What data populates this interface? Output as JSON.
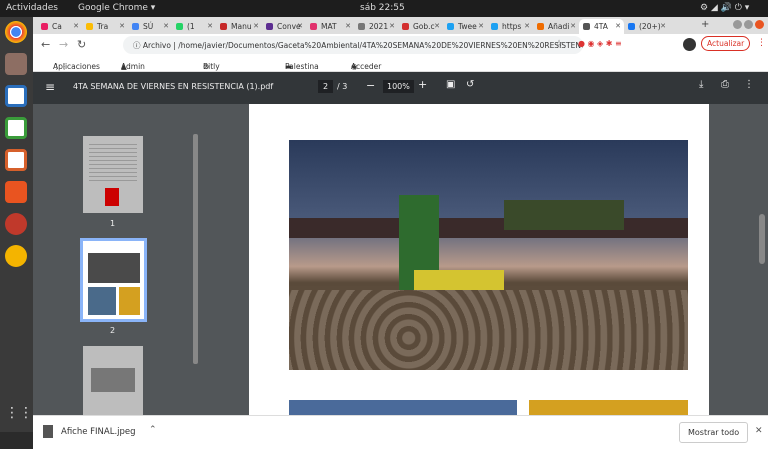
{
  "system": {
    "activities": "Actividades",
    "app": "Google Chrome ▾",
    "clock": "sáb 22:55"
  },
  "tabs": [
    {
      "label": "Ca",
      "color": "#e91e63"
    },
    {
      "label": "Tra",
      "color": "#fbbc04"
    },
    {
      "label": "SÚ",
      "color": "#4285f4"
    },
    {
      "label": "(1",
      "color": "#25d366"
    },
    {
      "label": "Manu",
      "color": "#c62828"
    },
    {
      "label": "Conve",
      "color": "#5c2d91"
    },
    {
      "label": "MAT",
      "color": "#e1306c"
    },
    {
      "label": "2021",
      "color": "#777"
    },
    {
      "label": "Gob.c",
      "color": "#d32f2f"
    },
    {
      "label": "Twee",
      "color": "#1da1f2"
    },
    {
      "label": "https",
      "color": "#1da1f2"
    },
    {
      "label": "Añadi",
      "color": "#ef6c00"
    },
    {
      "label": "4TA",
      "color": "#555"
    },
    {
      "label": "(20+)",
      "color": "#1877f2"
    }
  ],
  "address": {
    "prefix": "Archivo",
    "url": "/home/javier/Documentos/Gaceta%20Ambiental/4TA%20SEMANA%20DE%20VIERNES%20EN%20RESISTENC...",
    "update": "Actualizar"
  },
  "bookmarks": [
    "Aplicaciones",
    "Admin Gaceta...",
    "Bitly | URL Sho...",
    "Palestina",
    "Acceder < Tra..."
  ],
  "pdf": {
    "title": "4TA SEMANA DE VIERNES EN RESISTENCIA (1).pdf",
    "page": "2",
    "total": "/ 3",
    "zoom": "100%"
  },
  "thumbs": [
    "1",
    "2"
  ],
  "download": {
    "file": "Afiche FINAL.jpeg",
    "show_all": "Mostrar todo"
  }
}
